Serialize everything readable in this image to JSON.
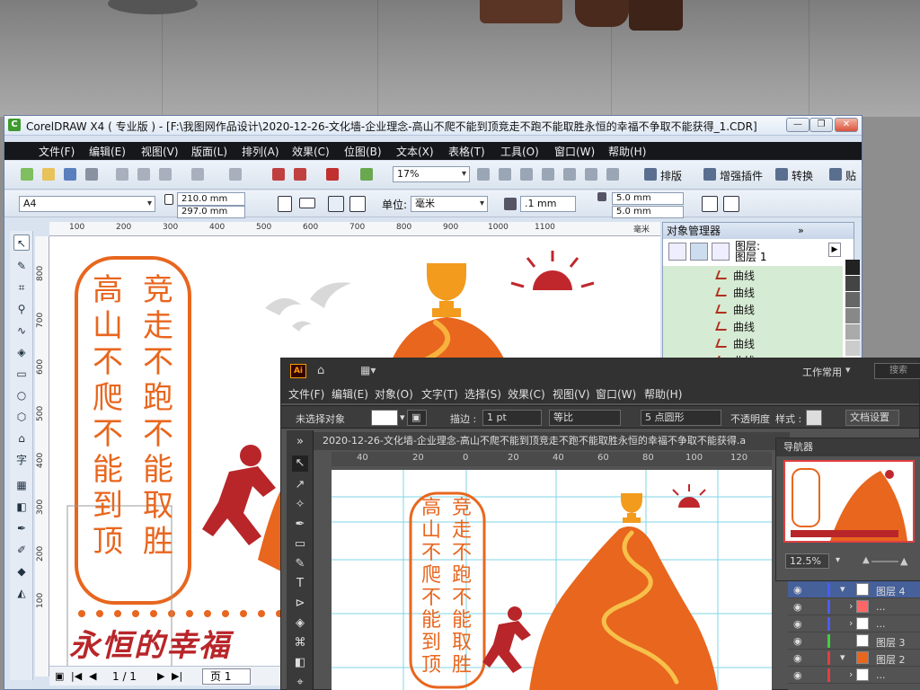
{
  "corel": {
    "title": "CorelDRAW X4 ( 专业版 ) - [F:\\我图网作品设计\\2020-12-26-文化墙-企业理念-高山不爬不能到顶竞走不跑不能取胜永恒的幸福不争取不能获得_1.CDR]",
    "menu": [
      "文件(F)",
      "编辑(E)",
      "视图(V)",
      "版面(L)",
      "排列(A)",
      "效果(C)",
      "位图(B)",
      "文本(X)",
      "表格(T)",
      "工具(O)",
      "窗口(W)",
      "帮助(H)"
    ],
    "zoom": "17%",
    "plugins": [
      "排版",
      "增强插件",
      "转换",
      "贴"
    ],
    "paper": "A4",
    "width": "210.0 mm",
    "height": "297.0 mm",
    "units_label": "单位:",
    "units": "毫米",
    "nudge": ".1 mm",
    "dup_x": "5.0 mm",
    "dup_y": "5.0 mm",
    "ruler": [
      "100",
      "200",
      "300",
      "400",
      "500",
      "600",
      "700",
      "800",
      "900",
      "1000",
      "1100",
      "毫米"
    ],
    "vruler": [
      "800",
      "700",
      "600",
      "500",
      "400",
      "300",
      "200",
      "100"
    ],
    "page_counter": "1 / 1",
    "page_tab": "页 1",
    "colors": {
      "accent": "#e8661e",
      "dark_red": "#b8262a"
    }
  },
  "artwork": {
    "col1": [
      "竞",
      "走",
      "不",
      "跑",
      "不",
      "能",
      "取",
      "胜"
    ],
    "col2": [
      "高",
      "山",
      "不",
      "爬",
      "不",
      "能",
      "到",
      "顶"
    ],
    "slogan": "永恒的幸福"
  },
  "objmgr": {
    "title": "对象管理器",
    "layer_lines": [
      "图层:",
      "图层 1"
    ],
    "items": [
      "曲线",
      "曲线",
      "曲线",
      "曲线",
      "曲线",
      "曲线"
    ]
  },
  "ai": {
    "workspace": "工作常用",
    "search": "搜索",
    "menu": [
      "文件(F)",
      "编辑(E)",
      "对象(O)",
      "文字(T)",
      "选择(S)",
      "效果(C)",
      "视图(V)",
      "窗口(W)",
      "帮助(H)"
    ],
    "no_selection": "未选择对象",
    "stroke_label": "描边 :",
    "stroke_value": "1 pt",
    "stroke_style": "等比",
    "brush": "5 点圆形",
    "opacity_label": "不透明度",
    "style_label": "样式 :",
    "doc_setup": "文档设置",
    "doc_tab": "2020-12-26-文化墙-企业理念-高山不爬不能到顶竞走不跑不能取胜永恒的幸福不争取不能获得.a",
    "ruler": [
      "40",
      "20",
      "0",
      "20",
      "40",
      "60",
      "80",
      "100",
      "120"
    ],
    "nav_title": "导航器",
    "nav_zoom": "12.5%",
    "layers": [
      {
        "name": "图层 4",
        "color": "#4b5cff"
      },
      {
        "name": "...",
        "color": "#4b5cff"
      },
      {
        "name": "...",
        "color": "#4b5cff"
      },
      {
        "name": "图层 3",
        "color": "#40d040"
      },
      {
        "name": "图层 2",
        "color": "#e04040"
      },
      {
        "name": "...",
        "color": "#e04040"
      },
      {
        "name": "...",
        "color": "#e04040"
      }
    ]
  }
}
